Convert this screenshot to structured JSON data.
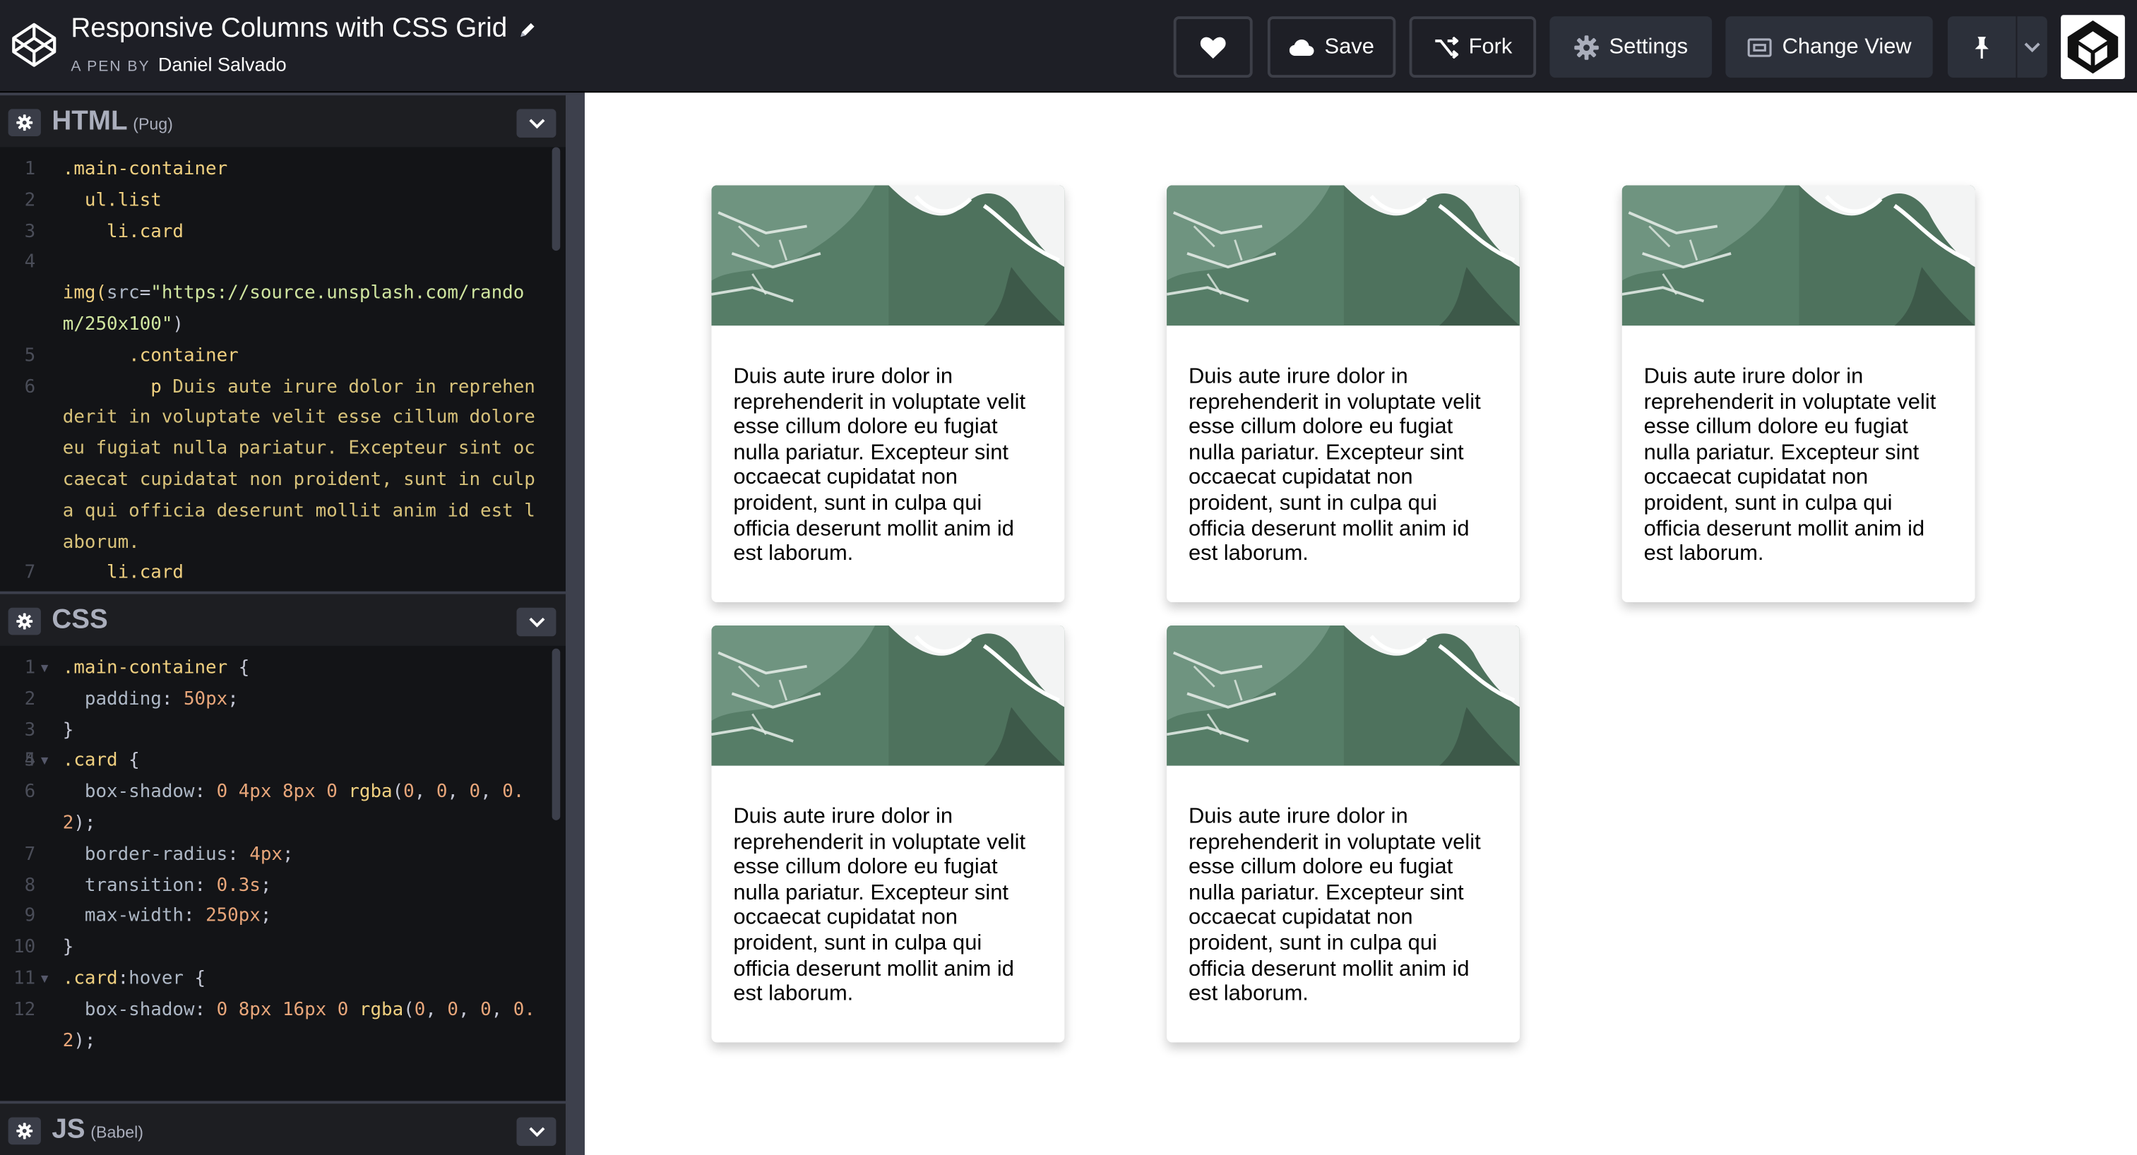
{
  "header": {
    "title": "Responsive Columns with CSS Grid",
    "byline_prefix": "A PEN BY",
    "author": "Daniel Salvado",
    "buttons": {
      "save": "Save",
      "fork": "Fork",
      "settings": "Settings",
      "change_view": "Change View"
    }
  },
  "panels": {
    "html": {
      "name": "HTML",
      "sub": "(Pug)"
    },
    "css": {
      "name": "CSS",
      "sub": ""
    },
    "js": {
      "name": "JS",
      "sub": "(Babel)"
    }
  },
  "html_code": [
    {
      "n": "1",
      "parts": [
        {
          "c": "t-sel",
          "t": ".main-container"
        }
      ]
    },
    {
      "n": "2",
      "parts": [
        {
          "c": "t-sel",
          "t": "  ul.list"
        }
      ]
    },
    {
      "n": "3",
      "parts": [
        {
          "c": "t-sel",
          "t": "    li.card"
        }
      ]
    },
    {
      "n": "4",
      "parts": [
        {
          "c": "t-sel",
          "t": "      "
        }
      ]
    },
    {
      "n": "",
      "parts": [
        {
          "c": "t-fn",
          "t": "img("
        },
        {
          "c": "t-prop",
          "t": "src"
        },
        {
          "c": "t-punc",
          "t": "="
        },
        {
          "c": "t-str",
          "t": "\"https://source.unsplash.com/random/250x100\""
        },
        {
          "c": "t-punc",
          "t": ")"
        }
      ]
    },
    {
      "n": "5",
      "parts": [
        {
          "c": "t-sel",
          "t": "      .container"
        }
      ]
    },
    {
      "n": "6",
      "parts": [
        {
          "c": "t-sel",
          "t": "        p "
        },
        {
          "c": "t-text",
          "t": "Duis aute irure dolor in reprehenderit in voluptate velit esse cillum dolore eu fugiat nulla pariatur. Excepteur sint occaecat cupidatat non proident, sunt in culpa qui officia deserunt mollit anim id est laborum."
        }
      ]
    },
    {
      "n": "7",
      "parts": [
        {
          "c": "t-sel",
          "t": "    li.card"
        }
      ]
    }
  ],
  "css_code": [
    {
      "n": "1",
      "fold": true,
      "parts": [
        {
          "c": "t-sel",
          "t": ".main-container"
        },
        {
          "c": "t-punc",
          "t": " {"
        }
      ]
    },
    {
      "n": "2",
      "parts": [
        {
          "c": "t-prop",
          "t": "  padding"
        },
        {
          "c": "t-punc",
          "t": ": "
        },
        {
          "c": "t-num",
          "t": "50px"
        },
        {
          "c": "t-punc",
          "t": ";"
        }
      ]
    },
    {
      "n": "3",
      "parts": [
        {
          "c": "t-punc",
          "t": "}"
        }
      ]
    },
    {
      "n": "4",
      "parts": [
        {
          "c": "t-punc",
          "t": ""
        }
      ]
    },
    {
      "n": "5",
      "fold": true,
      "parts": [
        {
          "c": "t-sel",
          "t": ".card"
        },
        {
          "c": "t-punc",
          "t": " {"
        }
      ]
    },
    {
      "n": "6",
      "parts": [
        {
          "c": "t-prop",
          "t": "  box-shadow"
        },
        {
          "c": "t-punc",
          "t": ": "
        },
        {
          "c": "t-num",
          "t": "0 4px 8px 0 "
        },
        {
          "c": "t-fn",
          "t": "rgba"
        },
        {
          "c": "t-punc",
          "t": "("
        },
        {
          "c": "t-num",
          "t": "0"
        },
        {
          "c": "t-punc",
          "t": ", "
        },
        {
          "c": "t-num",
          "t": "0"
        },
        {
          "c": "t-punc",
          "t": ", "
        },
        {
          "c": "t-num",
          "t": "0"
        },
        {
          "c": "t-punc",
          "t": ", "
        },
        {
          "c": "t-num",
          "t": "0.2"
        },
        {
          "c": "t-punc",
          "t": ");"
        }
      ]
    },
    {
      "n": "7",
      "parts": [
        {
          "c": "t-prop",
          "t": "  border-radius"
        },
        {
          "c": "t-punc",
          "t": ": "
        },
        {
          "c": "t-num",
          "t": "4px"
        },
        {
          "c": "t-punc",
          "t": ";"
        }
      ]
    },
    {
      "n": "8",
      "parts": [
        {
          "c": "t-prop",
          "t": "  transition"
        },
        {
          "c": "t-punc",
          "t": ": "
        },
        {
          "c": "t-num",
          "t": "0.3s"
        },
        {
          "c": "t-punc",
          "t": ";"
        }
      ]
    },
    {
      "n": "9",
      "parts": [
        {
          "c": "t-prop",
          "t": "  max-width"
        },
        {
          "c": "t-punc",
          "t": ": "
        },
        {
          "c": "t-num",
          "t": "250px"
        },
        {
          "c": "t-punc",
          "t": ";"
        }
      ]
    },
    {
      "n": "10",
      "parts": [
        {
          "c": "t-punc",
          "t": "}"
        }
      ]
    },
    {
      "n": "11",
      "fold": true,
      "parts": [
        {
          "c": "t-sel",
          "t": ".card"
        },
        {
          "c": "t-punc",
          "t": ":"
        },
        {
          "c": "t-prop",
          "t": "hover"
        },
        {
          "c": "t-punc",
          "t": " {"
        }
      ]
    },
    {
      "n": "12",
      "parts": [
        {
          "c": "t-prop",
          "t": "  box-shadow"
        },
        {
          "c": "t-punc",
          "t": ": "
        },
        {
          "c": "t-num",
          "t": "0 8px 16px 0 "
        },
        {
          "c": "t-fn",
          "t": "rgba"
        },
        {
          "c": "t-punc",
          "t": "("
        },
        {
          "c": "t-num",
          "t": "0"
        },
        {
          "c": "t-punc",
          "t": ", "
        },
        {
          "c": "t-num",
          "t": "0"
        },
        {
          "c": "t-punc",
          "t": ", "
        },
        {
          "c": "t-num",
          "t": "0"
        },
        {
          "c": "t-punc",
          "t": ", "
        },
        {
          "c": "t-num",
          "t": "0.2"
        },
        {
          "c": "t-punc",
          "t": ");"
        }
      ]
    }
  ],
  "cards": [
    {
      "text": "Duis aute irure dolor in reprehenderit in voluptate velit esse cillum dolore eu fugiat nulla pariatur. Excepteur sint occaecat cupidatat non proident, sunt in culpa qui officia deserunt mollit anim id est laborum."
    },
    {
      "text": "Duis aute irure dolor in reprehenderit in voluptate velit esse cillum dolore eu fugiat nulla pariatur. Excepteur sint occaecat cupidatat non proident, sunt in culpa qui officia deserunt mollit anim id est laborum."
    },
    {
      "text": "Duis aute irure dolor in reprehenderit in voluptate velit esse cillum dolore eu fugiat nulla pariatur. Excepteur sint occaecat cupidatat non proident, sunt in culpa qui officia deserunt mollit anim id est laborum."
    },
    {
      "text": "Duis aute irure dolor in reprehenderit in voluptate velit esse cillum dolore eu fugiat nulla pariatur. Excepteur sint occaecat cupidatat non proident, sunt in culpa qui officia deserunt mollit anim id est laborum."
    },
    {
      "text": "Duis aute irure dolor in reprehenderit in voluptate velit esse cillum dolore eu fugiat nulla pariatur. Excepteur sint occaecat cupidatat non proident, sunt in culpa qui officia deserunt mollit anim id est laborum."
    }
  ],
  "icons": {
    "logo": "codepen-logo-icon",
    "edit": "pencil-icon",
    "heart": "heart-icon",
    "save": "cloud-icon",
    "fork": "fork-icon",
    "settings": "gear-icon",
    "change_view": "layout-icon",
    "pin": "pin-icon",
    "pin_menu": "chevron-down-icon",
    "panel_settings": "gear-icon",
    "panel_collapse": "chevron-down-icon"
  },
  "colors": {
    "header_bg": "#1e1f26",
    "editor_bg": "#131417",
    "button_bg": "#2c303a",
    "preview_bg": "#ffffff"
  }
}
